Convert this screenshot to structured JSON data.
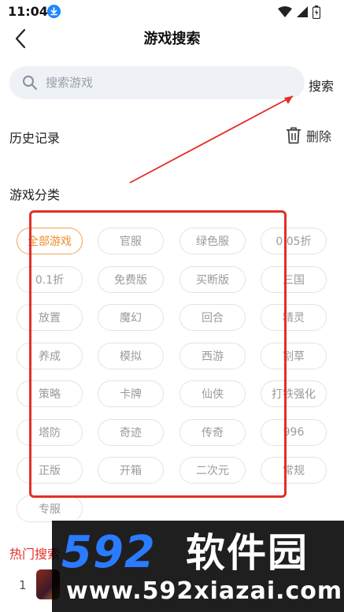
{
  "status_bar": {
    "time": "11:04"
  },
  "header": {
    "title": "游戏搜索"
  },
  "search": {
    "placeholder": "搜索游戏",
    "value": "",
    "button_label": "搜索"
  },
  "history": {
    "title": "历史记录",
    "delete_label": "删除"
  },
  "categories": {
    "title": "游戏分类",
    "items": [
      "全部游戏",
      "官服",
      "绿色服",
      "0.05折",
      "0.1折",
      "免费版",
      "买断版",
      "三国",
      "放置",
      "魔幻",
      "回合",
      "精灵",
      "养成",
      "模拟",
      "西游",
      "割草",
      "策略",
      "卡牌",
      "仙侠",
      "打铁强化",
      "塔防",
      "奇迹",
      "传奇",
      "996",
      "正版",
      "开箱",
      "二次元",
      "常规",
      "专服"
    ],
    "selected": "全部游戏"
  },
  "hot_search": {
    "title": "热门搜索",
    "items": [
      {
        "rank": "1"
      }
    ]
  },
  "watermark": {
    "logo_text": "592",
    "brand_cn": "软件园",
    "url": "www.592xiazai.com"
  },
  "colors": {
    "accent": "#f08c2a",
    "annotation": "#e0302a",
    "brand_blue": "#2a7bff"
  }
}
